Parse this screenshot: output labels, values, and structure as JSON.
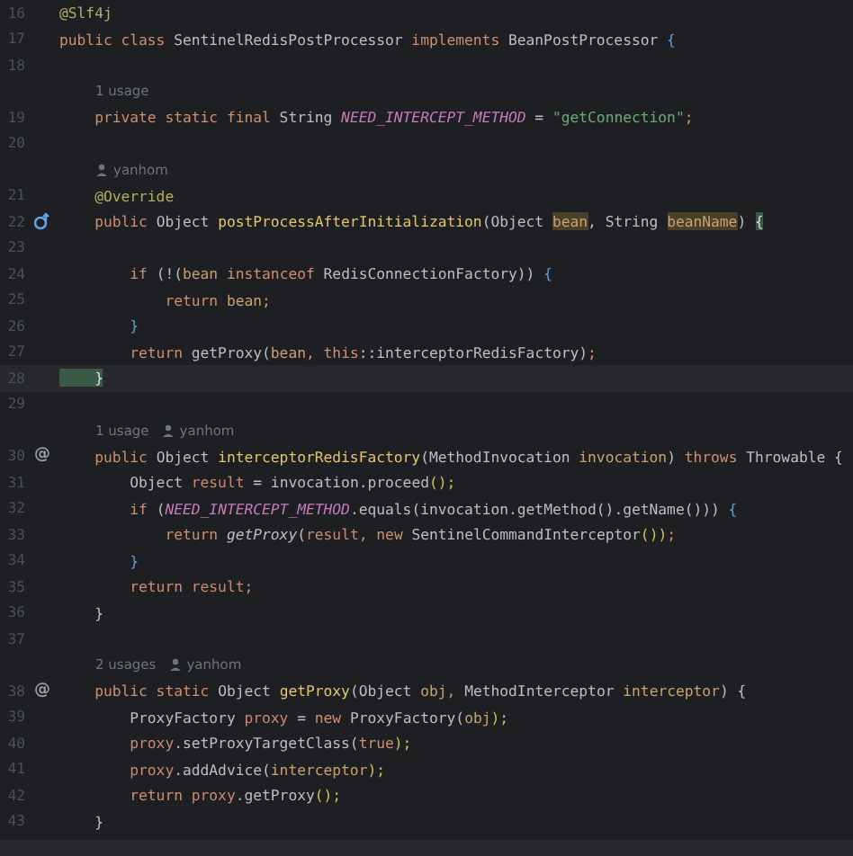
{
  "editor": {
    "lines": [
      {
        "kind": "code",
        "number": "16",
        "current": false,
        "tokens": [
          {
            "t": "@Slf4j",
            "kind": "annotation"
          }
        ]
      },
      {
        "kind": "code",
        "number": "17",
        "current": false,
        "tokens": [
          {
            "t": "public class ",
            "kind": "keyword"
          },
          {
            "t": "SentinelRedisPostProcessor ",
            "kind": "plain"
          },
          {
            "t": "implements ",
            "kind": "keyword"
          },
          {
            "t": "BeanPostProcessor ",
            "kind": "plain"
          },
          {
            "t": "{",
            "kind": "brace"
          }
        ]
      },
      {
        "kind": "code",
        "number": "18",
        "current": false
      },
      {
        "kind": "hint",
        "usages": "1 usage"
      },
      {
        "kind": "code",
        "number": "19",
        "current": false,
        "tokens": [
          {
            "t": "    private static final ",
            "kind": "keyword"
          },
          {
            "t": "String ",
            "kind": "plain"
          },
          {
            "t": "NEED_INTERCEPT_METHOD",
            "kind": "constant"
          },
          {
            "t": " = ",
            "kind": "plain"
          },
          {
            "t": "\"getConnection\"",
            "kind": "string"
          },
          {
            "t": ";",
            "kind": "keyword"
          }
        ]
      },
      {
        "kind": "code",
        "number": "20",
        "current": false
      },
      {
        "kind": "hint",
        "author": "yanhom"
      },
      {
        "kind": "code",
        "number": "21",
        "current": false,
        "tokens": [
          {
            "t": "    @Override",
            "kind": "annotation"
          }
        ]
      },
      {
        "kind": "code",
        "number": "22",
        "current": false,
        "gutter": {
          "kind": "implements"
        },
        "tokens": [
          {
            "t": "    public ",
            "kind": "keyword"
          },
          {
            "t": "Object ",
            "kind": "plain"
          },
          {
            "t": "postProcessAfterInitialization",
            "kind": "method"
          },
          {
            "t": "(Object ",
            "kind": "plain"
          },
          {
            "t": "bean",
            "kind": "usage"
          },
          {
            "t": ", String ",
            "kind": "plain"
          },
          {
            "t": "beanName",
            "kind": "usage"
          },
          {
            "t": ") ",
            "kind": "plain"
          },
          {
            "t": "{",
            "kind": "match"
          }
        ]
      },
      {
        "kind": "code",
        "number": "23",
        "current": false
      },
      {
        "kind": "code",
        "number": "24",
        "current": false,
        "tokens": [
          {
            "t": "        if ",
            "kind": "keyword"
          },
          {
            "t": "(!(",
            "kind": "plain"
          },
          {
            "t": "bean ",
            "kind": "param"
          },
          {
            "t": "instanceof ",
            "kind": "keyword"
          },
          {
            "t": "RedisConnectionFactory",
            "kind": "plain"
          },
          {
            "t": ")) ",
            "kind": "plain"
          },
          {
            "t": "{",
            "kind": "brace"
          }
        ]
      },
      {
        "kind": "code",
        "number": "25",
        "current": false,
        "tokens": [
          {
            "t": "            return ",
            "kind": "keyword"
          },
          {
            "t": "bean",
            "kind": "param"
          },
          {
            "t": ";",
            "kind": "keyword"
          }
        ]
      },
      {
        "kind": "code",
        "number": "26",
        "current": false,
        "tokens": [
          {
            "t": "        }",
            "kind": "brace"
          }
        ]
      },
      {
        "kind": "code",
        "number": "27",
        "current": false,
        "tokens": [
          {
            "t": "        return ",
            "kind": "keyword"
          },
          {
            "t": "getProxy(",
            "kind": "plain"
          },
          {
            "t": "bean",
            "kind": "param"
          },
          {
            "t": ", ",
            "kind": "keyword"
          },
          {
            "t": "this",
            "kind": "keyword"
          },
          {
            "t": "::interceptorRedisFactory)",
            "kind": "plain"
          },
          {
            "t": ";",
            "kind": "keyword"
          }
        ]
      },
      {
        "kind": "code",
        "number": "28",
        "current": true,
        "tokens": [
          {
            "t": "    }",
            "kind": "match"
          }
        ]
      },
      {
        "kind": "code",
        "number": "29",
        "current": false
      },
      {
        "kind": "hint",
        "usages": "1 usage",
        "author": "yanhom"
      },
      {
        "kind": "code",
        "number": "30",
        "current": false,
        "gutter": {
          "kind": "glyph",
          "text": "@"
        },
        "tokens": [
          {
            "t": "    public ",
            "kind": "keyword"
          },
          {
            "t": "Object ",
            "kind": "plain"
          },
          {
            "t": "interceptorRedisFactory",
            "kind": "method"
          },
          {
            "t": "(MethodInvocation ",
            "kind": "plain"
          },
          {
            "t": "invocation",
            "kind": "param"
          },
          {
            "t": ") ",
            "kind": "plain"
          },
          {
            "t": "throws ",
            "kind": "keyword"
          },
          {
            "t": "Throwable ",
            "kind": "plain"
          },
          {
            "t": "{",
            "kind": "plain"
          }
        ]
      },
      {
        "kind": "code",
        "number": "31",
        "current": false,
        "tokens": [
          {
            "t": "        Object ",
            "kind": "plain"
          },
          {
            "t": "result",
            "kind": "local"
          },
          {
            "t": " = ",
            "kind": "plain"
          },
          {
            "t": "invocation.proceed",
            "kind": "plain"
          },
          {
            "t": "();",
            "kind": "paren"
          }
        ]
      },
      {
        "kind": "code",
        "number": "32",
        "current": false,
        "tokens": [
          {
            "t": "        if ",
            "kind": "keyword"
          },
          {
            "t": "(",
            "kind": "plain"
          },
          {
            "t": "NEED_INTERCEPT_METHOD",
            "kind": "constant"
          },
          {
            "t": ".equals(invocation.getMethod().getName())) ",
            "kind": "plain"
          },
          {
            "t": "{",
            "kind": "brace"
          }
        ]
      },
      {
        "kind": "code",
        "number": "33",
        "current": false,
        "tokens": [
          {
            "t": "            return ",
            "kind": "keyword"
          },
          {
            "t": "getProxy",
            "kind": "static"
          },
          {
            "t": "(",
            "kind": "plain"
          },
          {
            "t": "result",
            "kind": "local"
          },
          {
            "t": ", ",
            "kind": "keyword"
          },
          {
            "t": "new ",
            "kind": "keyword"
          },
          {
            "t": "SentinelCommandInterceptor",
            "kind": "plain"
          },
          {
            "t": "())",
            "kind": "paren"
          },
          {
            "t": ";",
            "kind": "keyword"
          }
        ]
      },
      {
        "kind": "code",
        "number": "34",
        "current": false,
        "tokens": [
          {
            "t": "        }",
            "kind": "brace"
          }
        ]
      },
      {
        "kind": "code",
        "number": "35",
        "current": false,
        "tokens": [
          {
            "t": "        return ",
            "kind": "keyword"
          },
          {
            "t": "result",
            "kind": "local"
          },
          {
            "t": ";",
            "kind": "keyword"
          }
        ]
      },
      {
        "kind": "code",
        "number": "36",
        "current": false,
        "tokens": [
          {
            "t": "    }",
            "kind": "plain"
          }
        ]
      },
      {
        "kind": "code",
        "number": "37",
        "current": false
      },
      {
        "kind": "hint",
        "usages": "2 usages",
        "author": "yanhom"
      },
      {
        "kind": "code",
        "number": "38",
        "current": false,
        "gutter": {
          "kind": "glyph",
          "text": "@"
        },
        "tokens": [
          {
            "t": "    public static ",
            "kind": "keyword"
          },
          {
            "t": "Object ",
            "kind": "plain"
          },
          {
            "t": "getProxy",
            "kind": "method"
          },
          {
            "t": "(Object ",
            "kind": "plain"
          },
          {
            "t": "obj",
            "kind": "param"
          },
          {
            "t": ", ",
            "kind": "keyword"
          },
          {
            "t": "MethodInterceptor ",
            "kind": "plain"
          },
          {
            "t": "interceptor",
            "kind": "param"
          },
          {
            "t": ") ",
            "kind": "plain"
          },
          {
            "t": "{",
            "kind": "plain"
          }
        ]
      },
      {
        "kind": "code",
        "number": "39",
        "current": false,
        "tokens": [
          {
            "t": "        ProxyFactory ",
            "kind": "plain"
          },
          {
            "t": "proxy",
            "kind": "local"
          },
          {
            "t": " = ",
            "kind": "plain"
          },
          {
            "t": "new ",
            "kind": "keyword"
          },
          {
            "t": "ProxyFactory(",
            "kind": "plain"
          },
          {
            "t": "obj",
            "kind": "param"
          },
          {
            "t": ");",
            "kind": "paren"
          }
        ]
      },
      {
        "kind": "code",
        "number": "40",
        "current": false,
        "tokens": [
          {
            "t": "        proxy",
            "kind": "local"
          },
          {
            "t": ".setProxyTargetClass(",
            "kind": "plain"
          },
          {
            "t": "true",
            "kind": "keyword"
          },
          {
            "t": ");",
            "kind": "paren"
          }
        ]
      },
      {
        "kind": "code",
        "number": "41",
        "current": false,
        "tokens": [
          {
            "t": "        proxy",
            "kind": "local"
          },
          {
            "t": ".addAdvice(",
            "kind": "plain"
          },
          {
            "t": "interceptor",
            "kind": "param"
          },
          {
            "t": ");",
            "kind": "paren"
          }
        ]
      },
      {
        "kind": "code",
        "number": "42",
        "current": false,
        "tokens": [
          {
            "t": "        return ",
            "kind": "keyword"
          },
          {
            "t": "proxy",
            "kind": "local"
          },
          {
            "t": ".getProxy",
            "kind": "plain"
          },
          {
            "t": "();",
            "kind": "paren"
          }
        ]
      },
      {
        "kind": "code",
        "number": "43",
        "current": false,
        "tokens": [
          {
            "t": "    }",
            "kind": "plain"
          }
        ]
      }
    ]
  }
}
